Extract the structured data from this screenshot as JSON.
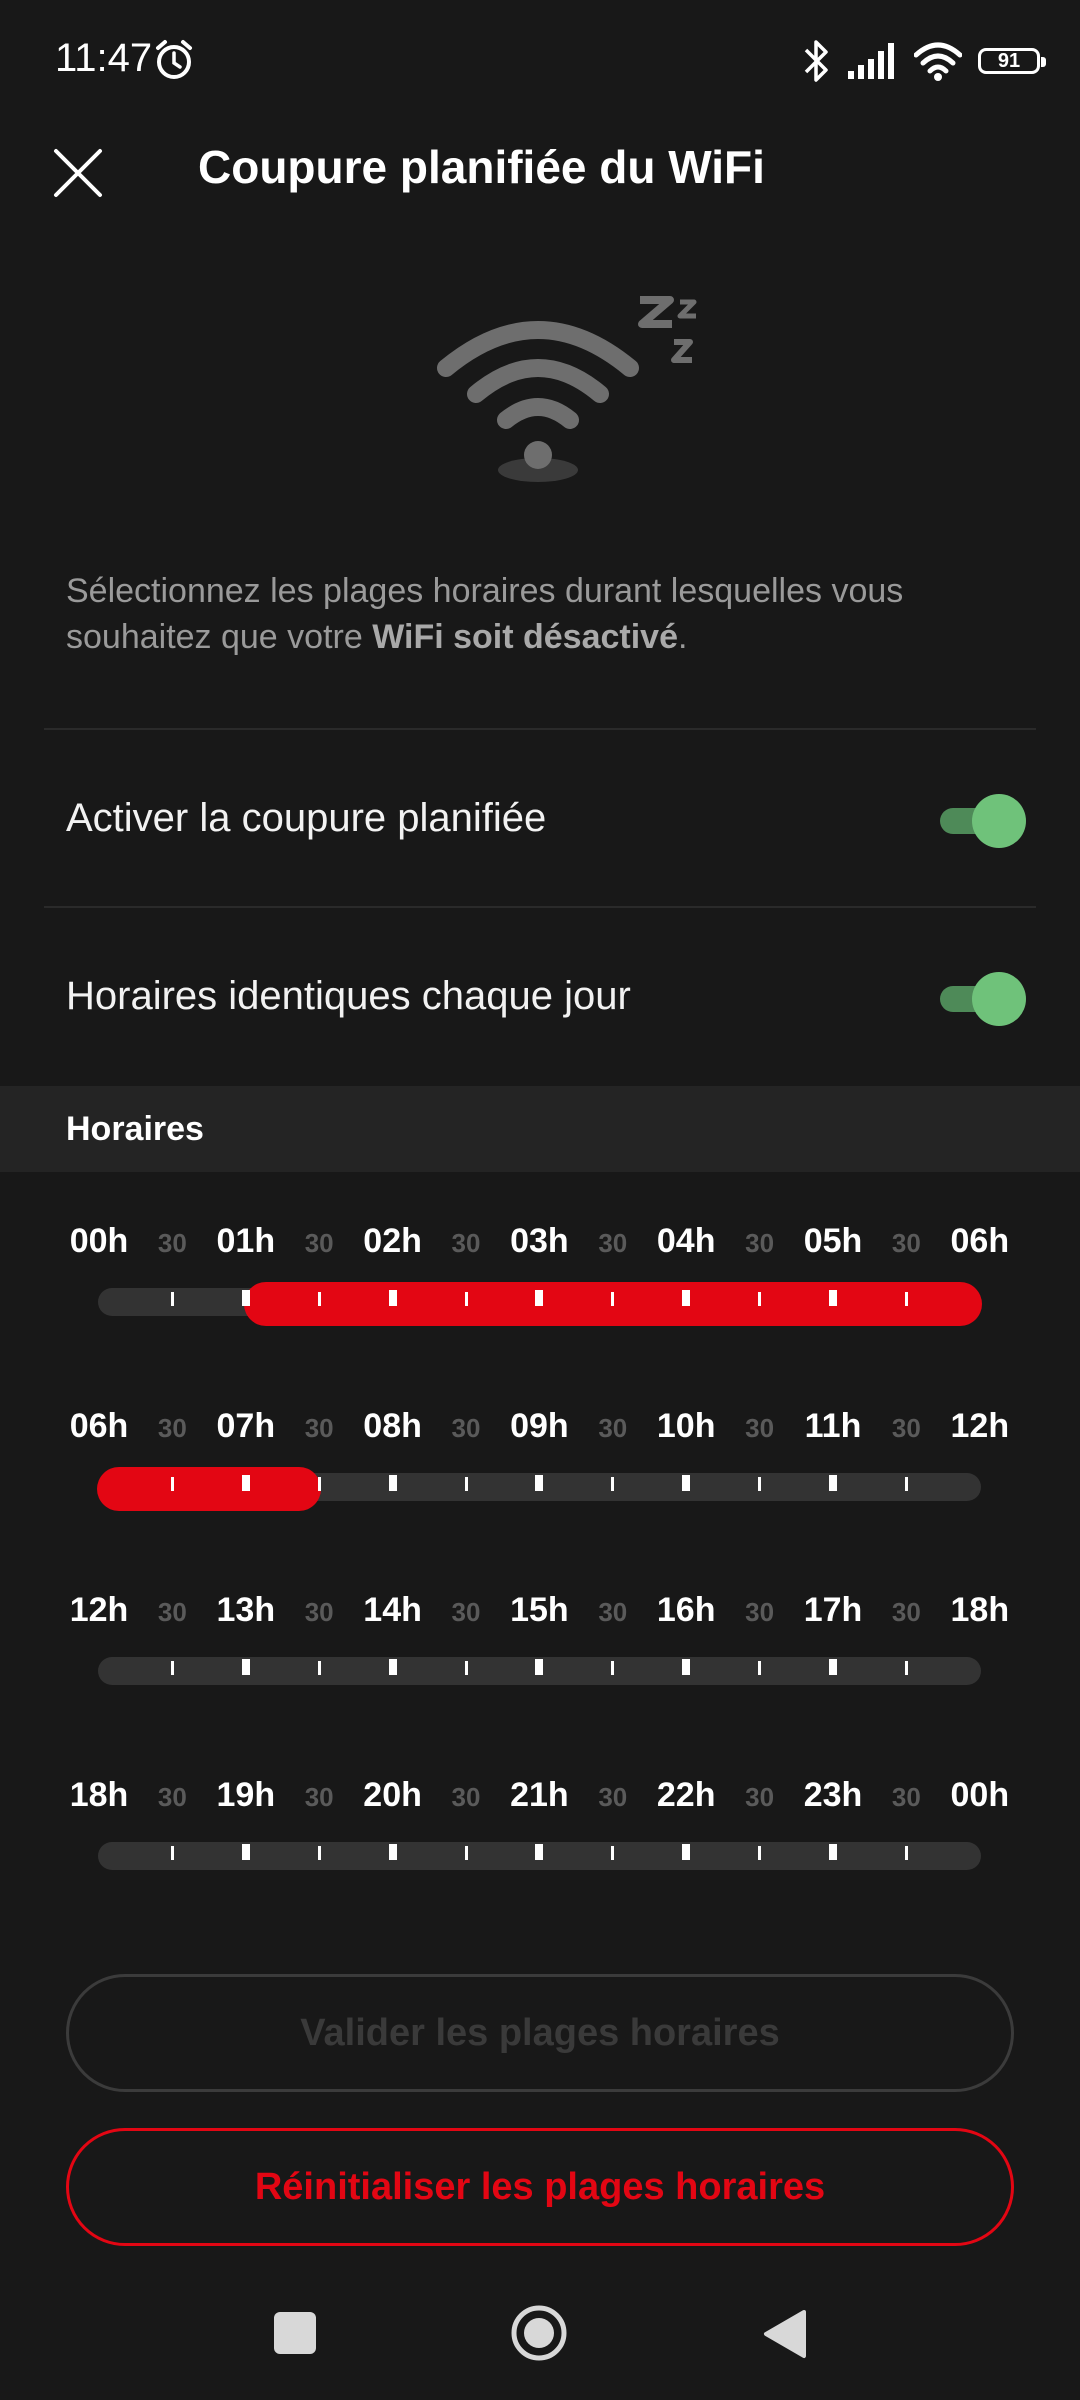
{
  "status_bar": {
    "time": "11:47",
    "battery": "91",
    "icons": [
      "alarm-icon",
      "bluetooth-icon",
      "signal-icon",
      "wifi-icon",
      "battery-icon"
    ]
  },
  "header": {
    "title": "Coupure planifiée du WiFi",
    "close_icon": "close-icon"
  },
  "illustration": "wifi-sleep-icon",
  "description": {
    "prefix": "Sélectionnez les plages horaires durant lesquelles vous souhaitez que votre ",
    "bold": "WiFi soit désactivé",
    "suffix": "."
  },
  "toggles": [
    {
      "label": "Activer la coupure planifiée",
      "on": true
    },
    {
      "label": "Horaires identiques chaque jour",
      "on": true
    }
  ],
  "section_title": "Horaires",
  "half_label": "30",
  "schedule_rows": [
    {
      "labels": [
        "00h",
        "01h",
        "02h",
        "03h",
        "04h",
        "05h",
        "06h"
      ],
      "off_ranges": [
        [
          "01:00",
          "06:00"
        ]
      ]
    },
    {
      "labels": [
        "06h",
        "07h",
        "08h",
        "09h",
        "10h",
        "11h",
        "12h"
      ],
      "off_ranges": [
        [
          "06:00",
          "07:30"
        ]
      ]
    },
    {
      "labels": [
        "12h",
        "13h",
        "14h",
        "15h",
        "16h",
        "17h",
        "18h"
      ],
      "off_ranges": []
    },
    {
      "labels": [
        "18h",
        "19h",
        "20h",
        "21h",
        "22h",
        "23h",
        "00h"
      ],
      "off_ranges": []
    }
  ],
  "buttons": {
    "validate": "Valider les plages horaires",
    "reset": "Réinitialiser les plages horaires"
  },
  "colors": {
    "accent_red": "#e30613",
    "toggle_on": "#6fc27a",
    "background": "#181818"
  }
}
